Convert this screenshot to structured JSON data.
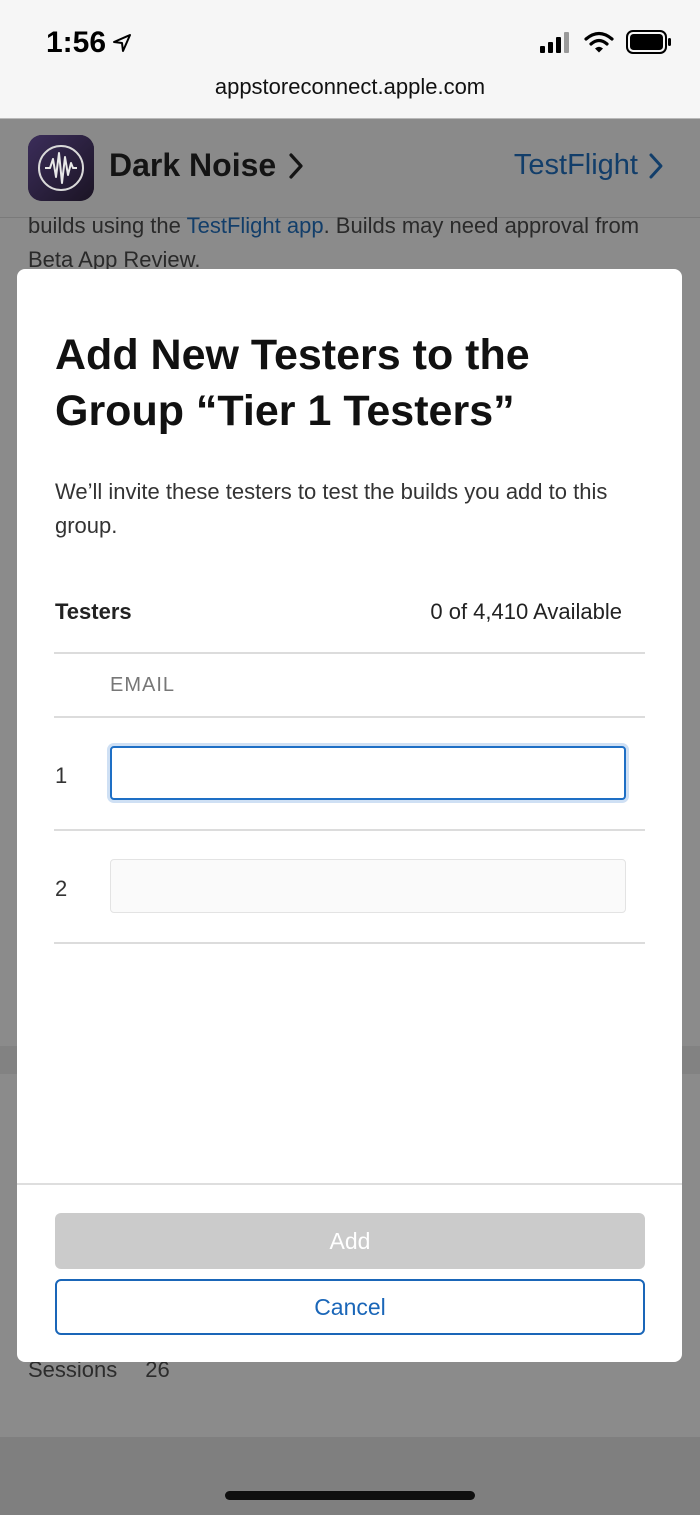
{
  "status_bar": {
    "time": "1:56",
    "url": "appstoreconnect.apple.com"
  },
  "background_page": {
    "app_name": "Dark Noise",
    "testflight_link": "TestFlight",
    "text_part1": "builds using the ",
    "text_link": "TestFlight app",
    "text_part2": ". Builds may need approval from Beta App Review.",
    "sessions_label": "Sessions",
    "sessions_value": "26"
  },
  "modal": {
    "title": "Add New Testers to the Group “Tier 1 Testers”",
    "description": "We’ll invite these testers to test the builds you add to this group.",
    "testers_label": "Testers",
    "available_text": "0 of 4,410 Available",
    "email_header": "EMAIL",
    "rows": [
      {
        "number": "1",
        "value": ""
      },
      {
        "number": "2",
        "value": ""
      }
    ],
    "add_button": "Add",
    "cancel_button": "Cancel"
  }
}
